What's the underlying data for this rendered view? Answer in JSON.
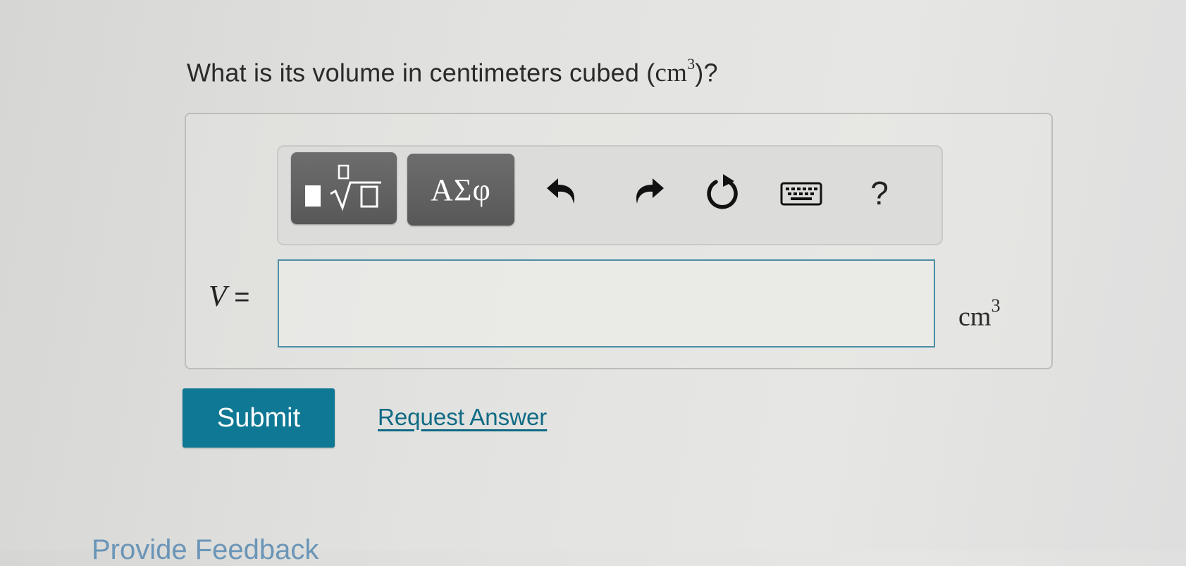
{
  "question": {
    "prefix": "What is its volume in centimeters cubed (",
    "unit_base": "cm",
    "unit_exponent": "3",
    "suffix": ")?"
  },
  "toolbar": {
    "templates_icon": "fraction-sqrt-template-icon",
    "symbols_label": "ΑΣφ",
    "undo_icon": "undo-icon",
    "redo_icon": "redo-icon",
    "reset_icon": "reset-icon",
    "keyboard_icon": "keyboard-icon",
    "help_label": "?"
  },
  "answer": {
    "variable": "V",
    "equals": "=",
    "value": "",
    "unit_base": "cm",
    "unit_exponent": "3"
  },
  "actions": {
    "submit_label": "Submit",
    "request_answer_label": "Request Answer",
    "provide_feedback_label": "Provide Feedback"
  },
  "colors": {
    "submit_bg": "#0f7894",
    "link": "#0f6a84",
    "input_border": "#4a8fa5",
    "tool_button": "#626262"
  }
}
